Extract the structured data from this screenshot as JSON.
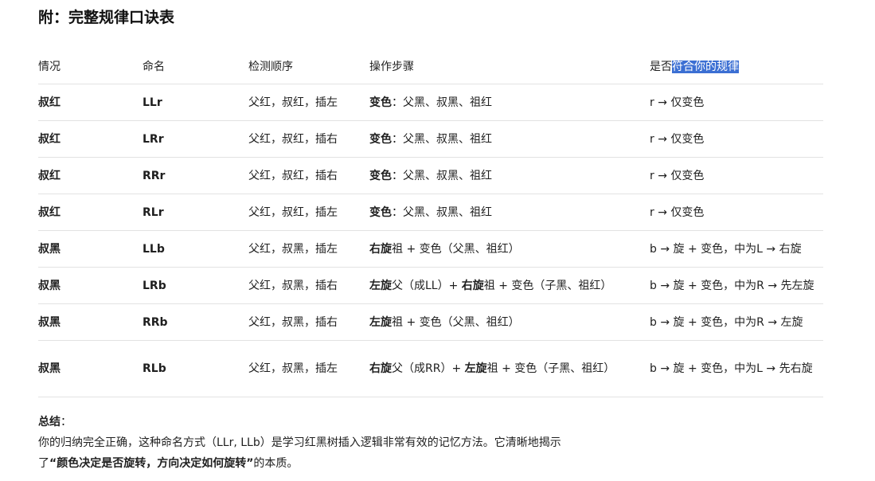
{
  "title": "附：完整规律口诀表",
  "headers": {
    "situation": "情况",
    "name": "命名",
    "order": "检测顺序",
    "steps": "操作步骤",
    "match_prefix": "是否",
    "match_highlight": "符合你的规律"
  },
  "rows": [
    {
      "situation": "叔红",
      "name": "LLr",
      "order": "父红，叔红，插左",
      "steps": [
        {
          "t": "变色",
          "b": true
        },
        {
          "t": "：父黑、叔黑、祖红",
          "b": false
        }
      ],
      "rule": "r → 仅变色"
    },
    {
      "situation": "叔红",
      "name": "LRr",
      "order": "父红，叔红，插右",
      "steps": [
        {
          "t": "变色",
          "b": true
        },
        {
          "t": "：父黑、叔黑、祖红",
          "b": false
        }
      ],
      "rule": "r → 仅变色"
    },
    {
      "situation": "叔红",
      "name": "RRr",
      "order": "父红，叔红，插右",
      "steps": [
        {
          "t": "变色",
          "b": true
        },
        {
          "t": "：父黑、叔黑、祖红",
          "b": false
        }
      ],
      "rule": "r → 仅变色"
    },
    {
      "situation": "叔红",
      "name": "RLr",
      "order": "父红，叔红，插左",
      "steps": [
        {
          "t": "变色",
          "b": true
        },
        {
          "t": "：父黑、叔黑、祖红",
          "b": false
        }
      ],
      "rule": "r → 仅变色"
    },
    {
      "situation": "叔黑",
      "name": "LLb",
      "order": "父红，叔黑，插左",
      "steps": [
        {
          "t": "右旋",
          "b": true
        },
        {
          "t": "祖 + 变色（父黑、祖红）",
          "b": false
        }
      ],
      "rule": "b → 旋 + 变色，中为L → 右旋"
    },
    {
      "situation": "叔黑",
      "name": "LRb",
      "order": "父红，叔黑，插右",
      "steps": [
        {
          "t": "左旋",
          "b": true
        },
        {
          "t": "父（成LL）+ ",
          "b": false
        },
        {
          "t": "右旋",
          "b": true
        },
        {
          "t": "祖 + 变色（子黑、祖红）",
          "b": false
        }
      ],
      "rule": "b → 旋 + 变色，中为R → 先左旋"
    },
    {
      "situation": "叔黑",
      "name": "RRb",
      "order": "父红，叔黑，插右",
      "steps": [
        {
          "t": "左旋",
          "b": true
        },
        {
          "t": "祖 + 变色（父黑、祖红）",
          "b": false
        }
      ],
      "rule": "b → 旋 + 变色，中为R → 左旋"
    },
    {
      "situation": "叔黑",
      "name": "RLb",
      "order": "父红，叔黑，插左",
      "steps": [
        {
          "t": "右旋",
          "b": true
        },
        {
          "t": "父（成RR）+ ",
          "b": false
        },
        {
          "t": "左旋",
          "b": true
        },
        {
          "t": "祖 + 变色（子黑、祖红）",
          "b": false
        }
      ],
      "rule": "b → 旋 + 变色，中为L → 先右旋"
    }
  ],
  "summary": {
    "label": "总结",
    "colon": "：",
    "line1": "你的归纳完全正确，这种命名方式（LLr, LLb）是学习红黑树插入逻辑非常有效的记忆方法。它清晰地揭示",
    "line2_prefix": "了",
    "line2_bold": "“颜色决定是否旋转，方向决定如何旋转”",
    "line2_suffix": "的本质。"
  }
}
